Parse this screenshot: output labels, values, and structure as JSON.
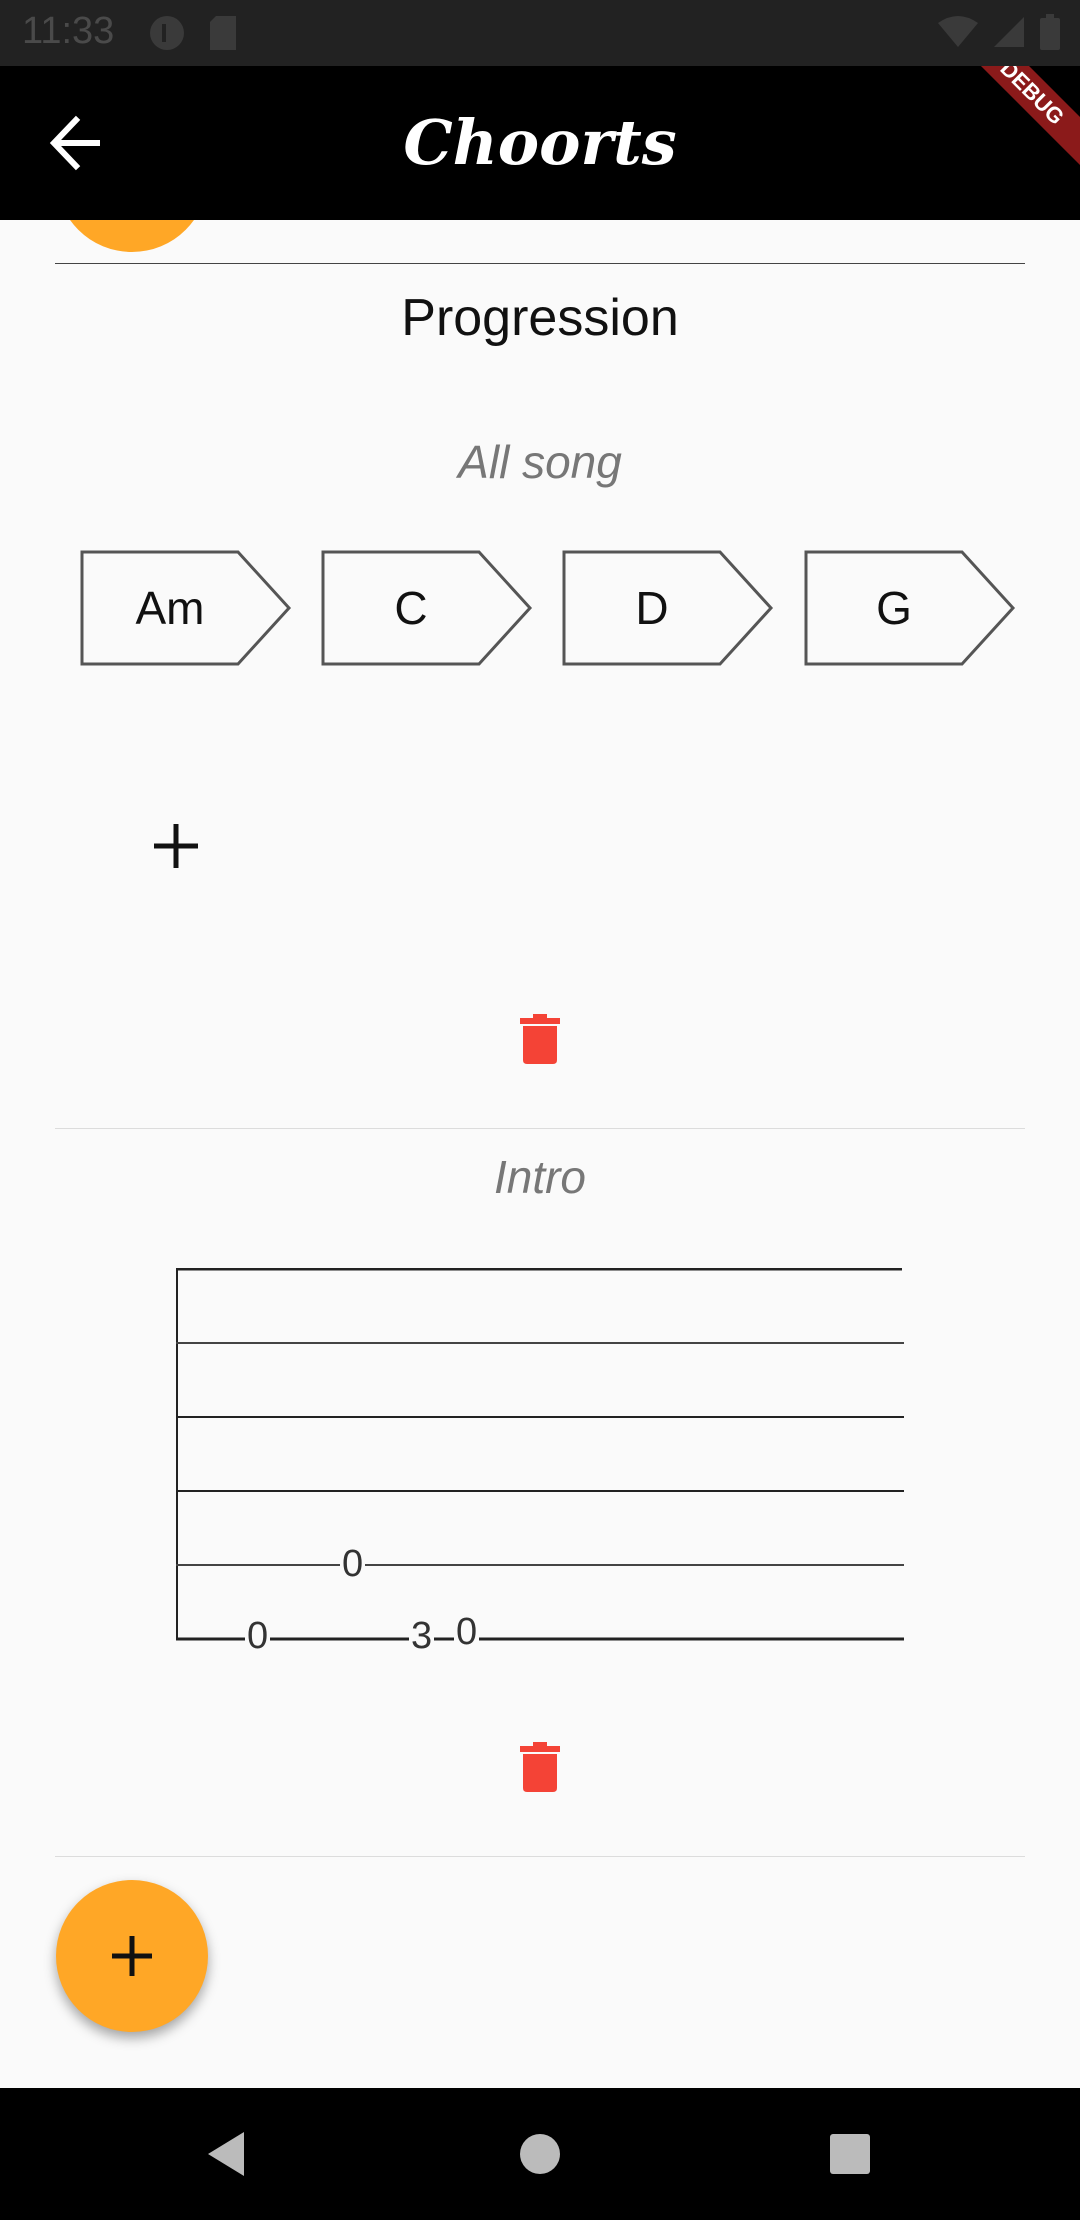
{
  "status_bar": {
    "time": "11:33"
  },
  "app_bar": {
    "title": "Choorts",
    "debug_label": "DEBUG"
  },
  "progression": {
    "title": "Progression",
    "subtitle": "All song",
    "chords": [
      "Am",
      "C",
      "D",
      "G"
    ]
  },
  "intro": {
    "subtitle": "Intro",
    "tab_numbers": [
      "0",
      "0",
      "3",
      "0"
    ]
  },
  "colors": {
    "accent": "#ffa726",
    "delete": "#f44336",
    "app_bar": "#000000"
  },
  "icons": {
    "back": "arrow-left-icon",
    "add": "plus-icon",
    "delete": "trash-icon"
  }
}
